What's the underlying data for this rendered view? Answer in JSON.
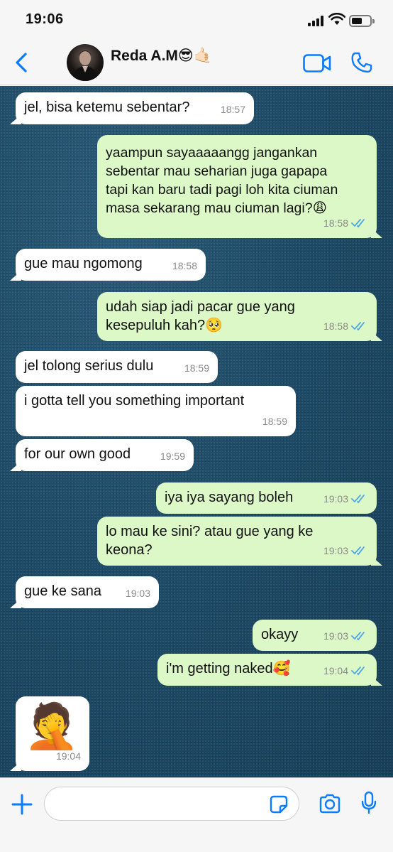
{
  "status_bar": {
    "time": "19:06"
  },
  "header": {
    "contact_name": "Reda A.M😎🤙🏻",
    "icons": {
      "back": "chevron-left-icon",
      "video": "video-camera-icon",
      "call": "phone-icon"
    }
  },
  "colors": {
    "accent": "#0a7cff",
    "incoming_bubble": "#ffffff",
    "outgoing_bubble": "#dcf8c6",
    "read_ticks": "#4fa6e6",
    "wallpaper": "#1e4d6b"
  },
  "messages": [
    {
      "direction": "in",
      "text": "jel, bisa ketemu sebentar?",
      "time": "18:57"
    },
    {
      "direction": "out",
      "text": "yaampun sayaaaaangg jangankan\nsebentar mau seharian juga gapapa\ntapi kan baru tadi pagi loh kita ciuman\nmasa sekarang mau ciuman lagi?😩",
      "time": "18:58",
      "status": "read"
    },
    {
      "direction": "in",
      "text": "gue mau ngomong",
      "time": "18:58"
    },
    {
      "direction": "out",
      "text": "udah siap jadi pacar gue yang\nkesepuluh kah?🥺",
      "time": "18:58",
      "status": "read"
    },
    {
      "direction": "in",
      "text": "jel tolong serius dulu",
      "time": "18:59"
    },
    {
      "direction": "in",
      "text": "i gotta tell you something important",
      "time": "18:59"
    },
    {
      "direction": "in",
      "text": "for our own good",
      "time": "19:59"
    },
    {
      "direction": "out",
      "text": "iya iya sayang boleh",
      "time": "19:03",
      "status": "read"
    },
    {
      "direction": "out",
      "text": "lo mau ke sini? atau gue yang ke\nkeona?",
      "time": "19:03",
      "status": "read"
    },
    {
      "direction": "in",
      "text": "gue ke sana",
      "time": "19:03"
    },
    {
      "direction": "out",
      "text": "okayy",
      "time": "19:03",
      "status": "read"
    },
    {
      "direction": "out",
      "text": "i'm getting naked🥰",
      "time": "19:04",
      "status": "read"
    },
    {
      "direction": "in",
      "text": "🤦",
      "time": "19:04",
      "type": "sticker"
    }
  ],
  "composer": {
    "value": "",
    "placeholder": "",
    "icons": {
      "add": "plus-icon",
      "sticker": "sticker-icon",
      "camera": "camera-icon",
      "mic": "microphone-icon"
    }
  }
}
